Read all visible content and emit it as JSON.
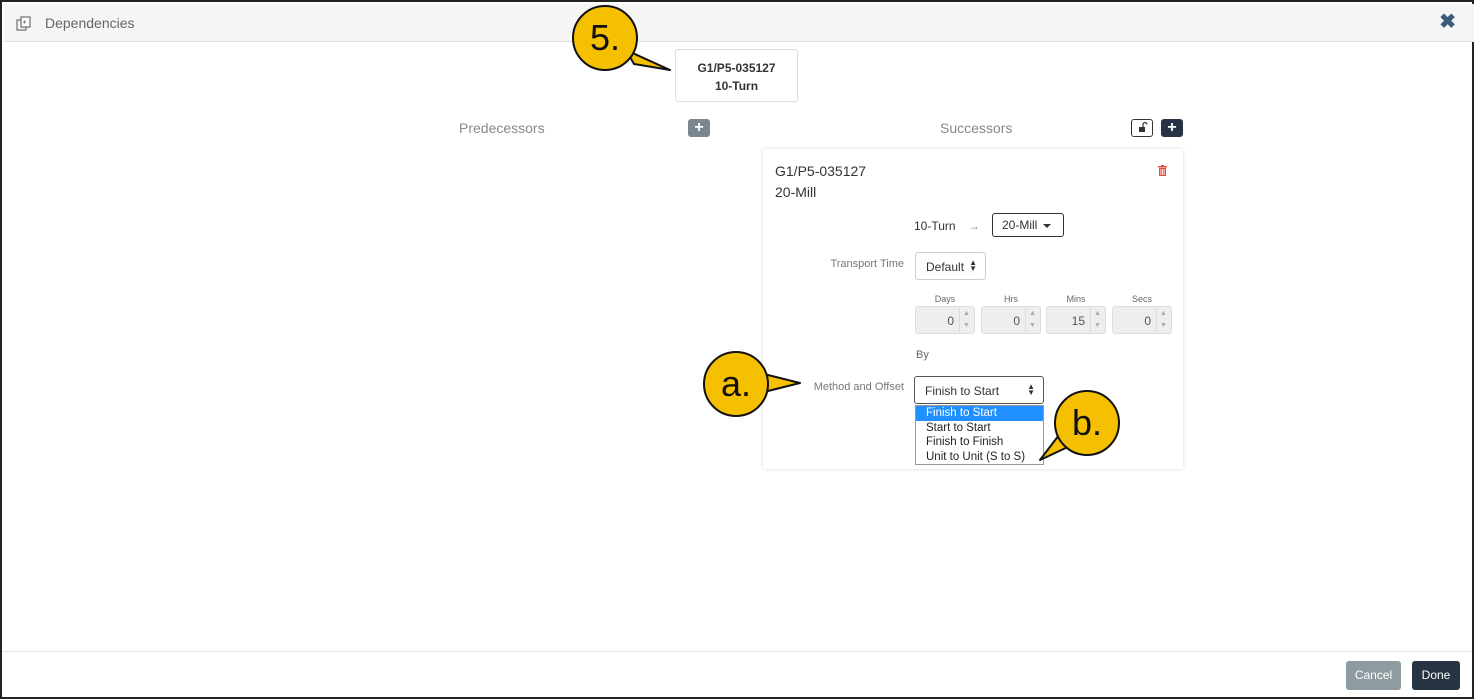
{
  "window": {
    "title": "Dependencies",
    "icon": "dependencies-icon",
    "close_icon": "close-icon"
  },
  "current_task": {
    "id": "G1/P5-035127",
    "operation": "10-Turn"
  },
  "columns": {
    "predecessors": "Predecessors",
    "successors": "Successors"
  },
  "successor": {
    "id": "G1/P5-035127",
    "operation": "20-Mill",
    "from_op": "10-Turn",
    "arrow": "→",
    "to_op": "20-Mill",
    "transport_time_label": "Transport Time",
    "transport_time_value": "Default",
    "units": [
      {
        "label": "Days",
        "value": "0"
      },
      {
        "label": "Hrs",
        "value": "0"
      },
      {
        "label": "Mins",
        "value": "15"
      },
      {
        "label": "Secs",
        "value": "0"
      }
    ],
    "by_label": "By",
    "method_label": "Method and Offset",
    "method_value": "Finish to Start",
    "method_options": [
      "Finish to Start",
      "Start to Start",
      "Finish to Finish",
      "Unit to Unit (S to S)"
    ]
  },
  "callouts": {
    "five": "5.",
    "a": "a.",
    "b": "b."
  },
  "footer": {
    "cancel": "Cancel",
    "done": "Done"
  },
  "colors": {
    "primary_dark": "#263342",
    "cancel_grey": "#8e9ba1",
    "callout_yellow": "#f5c000",
    "selected_blue": "#1e90ff",
    "delete_red": "#e74c3c"
  }
}
